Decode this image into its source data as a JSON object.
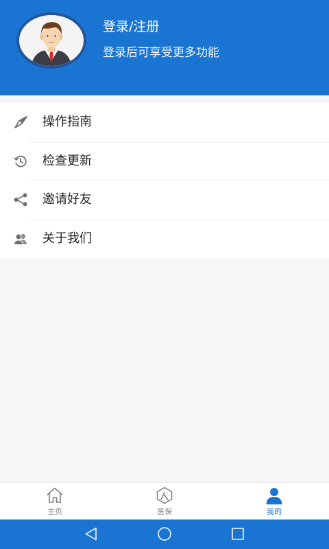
{
  "header": {
    "title": "登录/注册",
    "subtitle": "登录后可享受更多功能",
    "avatar_icon": "user-avatar-icon",
    "background_color": "#1a75d2"
  },
  "menu": {
    "items": [
      {
        "label": "操作指南",
        "icon": "compass-icon"
      },
      {
        "label": "检查更新",
        "icon": "refresh-clock-icon"
      },
      {
        "label": "邀请好友",
        "icon": "share-icon"
      },
      {
        "label": "关于我们",
        "icon": "users-icon"
      }
    ]
  },
  "tabbar": {
    "tabs": [
      {
        "label": "主页",
        "icon": "home-icon",
        "active": false
      },
      {
        "label": "医保",
        "icon": "person-shield-icon",
        "active": false
      },
      {
        "label": "我的",
        "icon": "profile-icon",
        "active": true
      }
    ],
    "active_color": "#1a75d2",
    "inactive_color": "#8a8a8a"
  },
  "system_nav": {
    "buttons": [
      "back-icon",
      "home-circle-icon",
      "recents-icon"
    ]
  }
}
